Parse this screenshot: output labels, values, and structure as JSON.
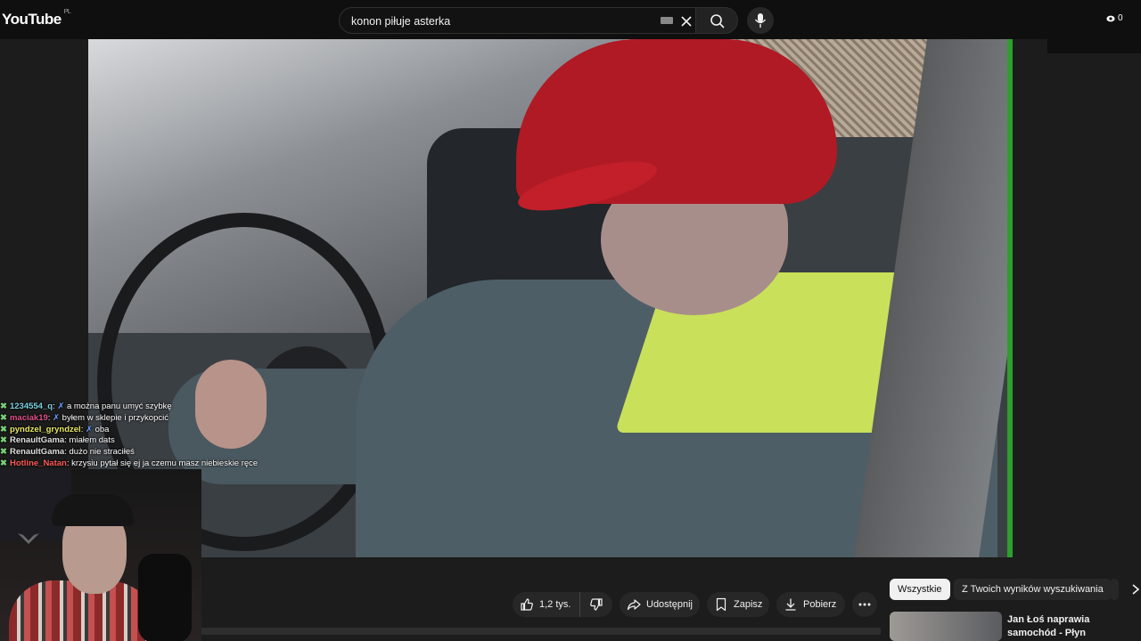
{
  "header": {
    "logo_text": "YouTube",
    "region_code": "PL",
    "search_value": "konon piłuje asterka",
    "viewer_count": "0"
  },
  "chat": [
    {
      "user": "1234554_q",
      "user_color": "#7ad0e0",
      "badge": "✗",
      "message": "a można panu umyć szybkę"
    },
    {
      "user": "maciak19",
      "user_color": "#e0508a",
      "badge": "✗",
      "message": "byłem w sklepie i przykopcić"
    },
    {
      "user": "pyndzel_gryndzel",
      "user_color": "#e8e860",
      "badge": "✗",
      "message": "oba"
    },
    {
      "user": "RenaultGama",
      "user_color": "#e0e0e0",
      "badge": "",
      "message": "miałem dats"
    },
    {
      "user": "RenaultGama",
      "user_color": "#e0e0e0",
      "badge": "",
      "message": "dużo nie straciłeś"
    },
    {
      "user": "Hotline_Natan",
      "user_color": "#ff5a5a",
      "badge": "",
      "message": "krzysiu pytał się ej ja czemu masz niebieskie ręce"
    }
  ],
  "actions": {
    "like_count": "1,2 tys.",
    "share_label": "Udostępnij",
    "save_label": "Zapisz",
    "download_label": "Pobierz"
  },
  "chips": {
    "all": "Wszystkie",
    "from_search": "Z Twoich wyników wyszukiwania"
  },
  "recommendation": {
    "title": "Jan Łoś naprawia samochód - Płyn chodnikowy"
  },
  "colors": {
    "background": "#0f0f0f",
    "pill": "#272727",
    "accent_green": "#2ba02b"
  }
}
